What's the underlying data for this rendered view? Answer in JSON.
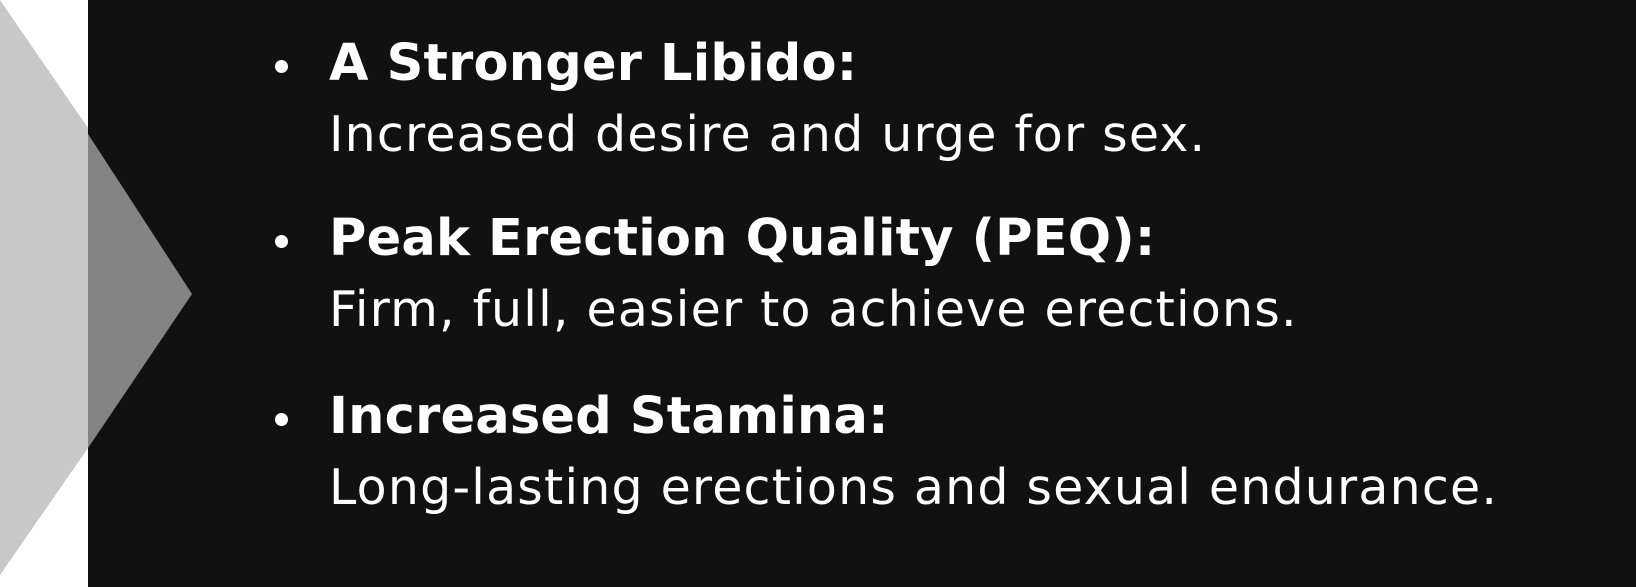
{
  "colors": {
    "background": "#ffffff",
    "panel": "#111111",
    "chevron_light": "#c8c8c8",
    "chevron_dark": "#848484",
    "text": "#ffffff"
  },
  "benefits": [
    {
      "title": "A Stronger Libido:",
      "description": "Increased desire and urge for sex."
    },
    {
      "title": "Peak Erection Quality (PEQ):",
      "description": "Firm, full, easier to achieve erections."
    },
    {
      "title": "Increased Stamina:",
      "description": "Long-lasting erections and sexual endurance."
    }
  ]
}
